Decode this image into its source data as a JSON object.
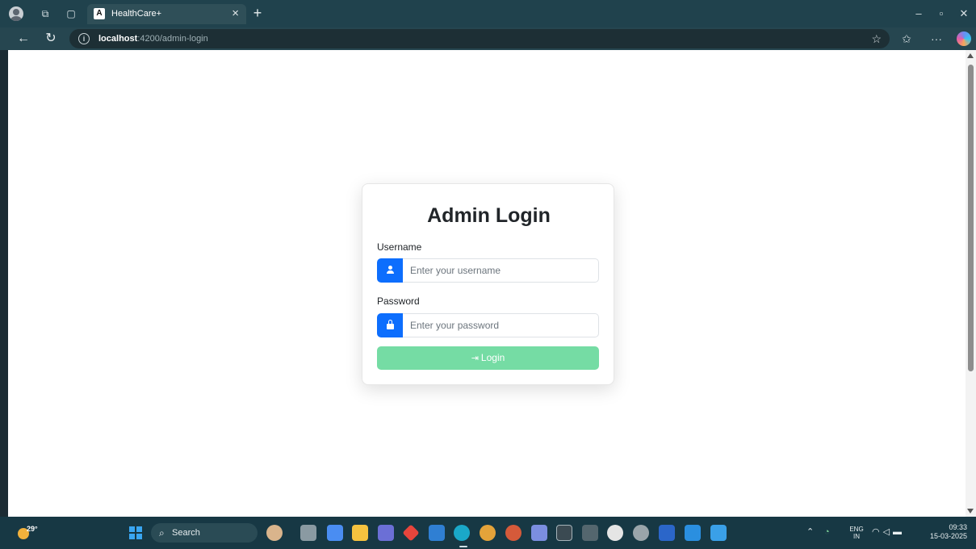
{
  "browser": {
    "tab_title": "HealthCare+",
    "tab_favicon_text": "A",
    "url_host": "localhost",
    "url_path": ":4200/admin-login"
  },
  "login": {
    "title": "Admin Login",
    "username_label": "Username",
    "username_placeholder": "Enter your username",
    "username_value": "",
    "password_label": "Password",
    "password_placeholder": "Enter your password",
    "password_value": "",
    "login_button": "Login",
    "button_color": "#75dca4",
    "accent_color": "#0d6efd"
  },
  "taskbar": {
    "weather_temp": "29°",
    "search_label": "Search",
    "language": "ENG",
    "region": "IN",
    "time": "09:33",
    "date": "15-03-2025"
  },
  "icons": [
    "user-icon",
    "lock-icon",
    "login-icon",
    "search-icon",
    "star-icon",
    "refresh-icon",
    "back-icon"
  ]
}
